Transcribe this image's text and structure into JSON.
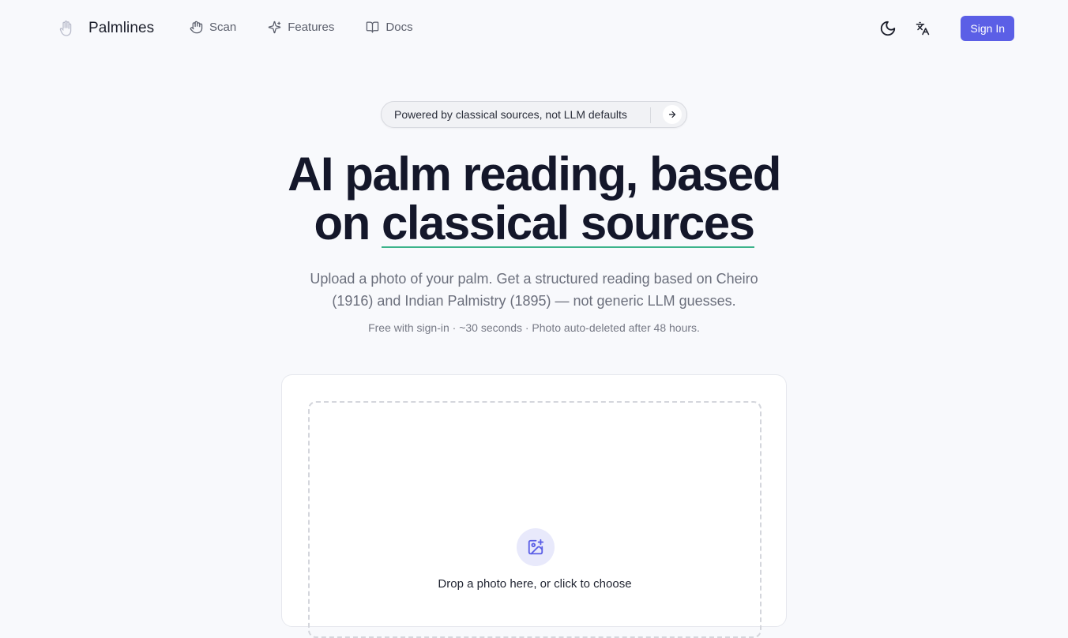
{
  "nav": {
    "brand": "Palmlines",
    "links": [
      {
        "label": "Scan",
        "icon": "hand-icon"
      },
      {
        "label": "Features",
        "icon": "sparkles-icon"
      },
      {
        "label": "Docs",
        "icon": "book-icon"
      }
    ],
    "theme_icon": "moon-icon",
    "language_icon": "translate-icon",
    "sign_in": "Sign In"
  },
  "hero": {
    "badge": "Powered by classical sources, not LLM defaults",
    "headline_line1": "AI palm reading, based",
    "headline_line2_prefix": "on ",
    "headline_line2_highlight": "classical sources",
    "subtitle": "Upload a photo of your palm. Get a structured reading based on Cheiro (1916) and Indian Palmistry (1895) — not generic LLM guesses.",
    "meta": "Free with sign-in · ~30 seconds · Photo auto-deleted after 48 hours."
  },
  "upload": {
    "prompt": "Drop a photo here, or click to choose",
    "icon": "image-plus-icon"
  },
  "colors": {
    "accent": "#5b5fe6",
    "underline": "#3bb38a",
    "background": "#f8f9fc"
  }
}
